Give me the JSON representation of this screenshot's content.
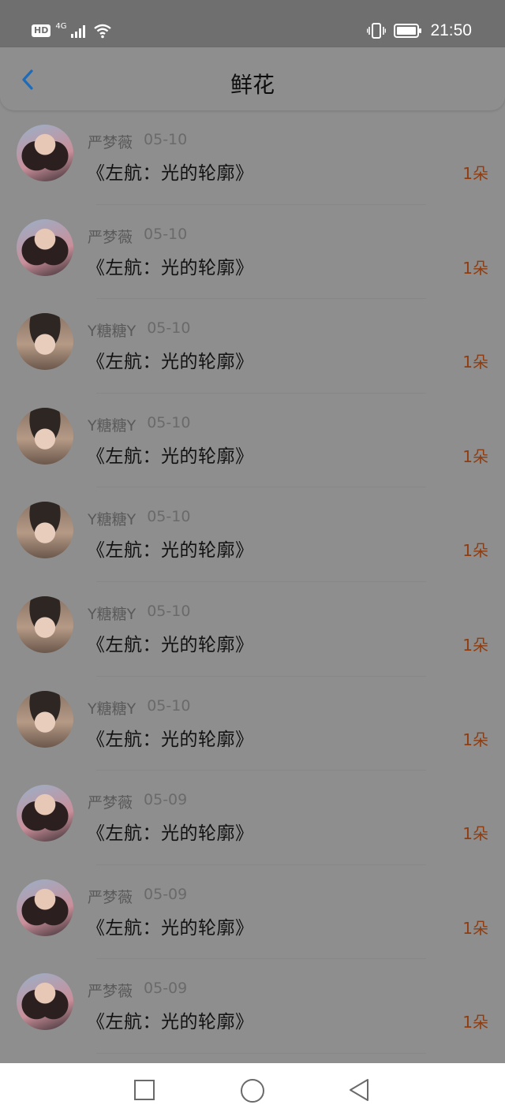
{
  "status_bar": {
    "hd_badge": "HD",
    "network": "4G",
    "time": "21:50"
  },
  "header": {
    "title": "鲜花",
    "back_icon": "chevron-left-icon",
    "back_color": "#1e6bb8"
  },
  "items": [
    {
      "user": "严梦薇",
      "date": "05-10",
      "title": "《左航：光的轮廓》",
      "amount": "1朵",
      "avatar": "avatar-a"
    },
    {
      "user": "严梦薇",
      "date": "05-10",
      "title": "《左航：光的轮廓》",
      "amount": "1朵",
      "avatar": "avatar-a"
    },
    {
      "user": "Y糖糖Y",
      "date": "05-10",
      "title": "《左航：光的轮廓》",
      "amount": "1朵",
      "avatar": "avatar-b"
    },
    {
      "user": "Y糖糖Y",
      "date": "05-10",
      "title": "《左航：光的轮廓》",
      "amount": "1朵",
      "avatar": "avatar-b"
    },
    {
      "user": "Y糖糖Y",
      "date": "05-10",
      "title": "《左航：光的轮廓》",
      "amount": "1朵",
      "avatar": "avatar-b"
    },
    {
      "user": "Y糖糖Y",
      "date": "05-10",
      "title": "《左航：光的轮廓》",
      "amount": "1朵",
      "avatar": "avatar-b"
    },
    {
      "user": "Y糖糖Y",
      "date": "05-10",
      "title": "《左航：光的轮廓》",
      "amount": "1朵",
      "avatar": "avatar-b"
    },
    {
      "user": "严梦薇",
      "date": "05-09",
      "title": "《左航：光的轮廓》",
      "amount": "1朵",
      "avatar": "avatar-a"
    },
    {
      "user": "严梦薇",
      "date": "05-09",
      "title": "《左航：光的轮廓》",
      "amount": "1朵",
      "avatar": "avatar-a"
    },
    {
      "user": "严梦薇",
      "date": "05-09",
      "title": "《左航：光的轮廓》",
      "amount": "1朵",
      "avatar": "avatar-a"
    }
  ],
  "colors": {
    "overlay_background": "#8e8e8e",
    "amount_color": "#8f3d10"
  },
  "nav_bar": {
    "recent_icon": "square-icon",
    "home_icon": "circle-icon",
    "back_icon": "triangle-back-icon"
  }
}
